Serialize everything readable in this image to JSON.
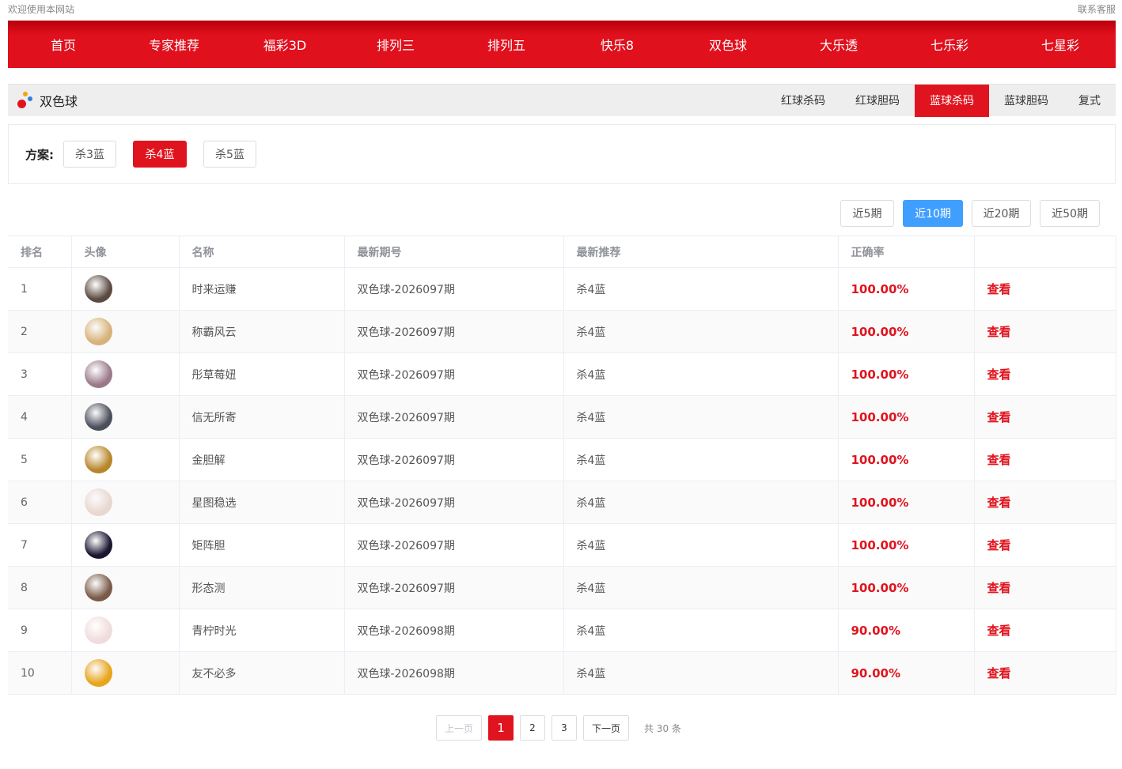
{
  "topbar": {
    "welcome": "欢迎使用本网站",
    "contact": "联系客服"
  },
  "nav": [
    "首页",
    "专家推荐",
    "福彩3D",
    "排列三",
    "排列五",
    "快乐8",
    "双色球",
    "大乐透",
    "七乐彩",
    "七星彩"
  ],
  "section": {
    "title": "双色球",
    "tabs": [
      "红球杀码",
      "红球胆码",
      "蓝球杀码",
      "蓝球胆码",
      "复式"
    ],
    "active_tab": "蓝球杀码"
  },
  "plan": {
    "label": "方案:",
    "options": [
      "杀3蓝",
      "杀4蓝",
      "杀5蓝"
    ],
    "active": "杀4蓝"
  },
  "periods": {
    "options": [
      "近5期",
      "近10期",
      "近20期",
      "近50期"
    ],
    "active": "近10期"
  },
  "table": {
    "headers": [
      "排名",
      "头像",
      "名称",
      "最新期号",
      "最新推荐",
      "正确率",
      ""
    ],
    "rows": [
      {
        "rank": "1",
        "avatar_color": "#5a4a40",
        "name": "时来运赚",
        "issue": "双色球-2026097期",
        "rec": "杀4蓝",
        "rate": "100.00%",
        "action": "查看"
      },
      {
        "rank": "2",
        "avatar_color": "#d8b27a",
        "name": "称霸风云",
        "issue": "双色球-2026097期",
        "rec": "杀4蓝",
        "rate": "100.00%",
        "action": "查看"
      },
      {
        "rank": "3",
        "avatar_color": "#9a7a8a",
        "name": "彤草莓妞",
        "issue": "双色球-2026097期",
        "rec": "杀4蓝",
        "rate": "100.00%",
        "action": "查看"
      },
      {
        "rank": "4",
        "avatar_color": "#4a4f5a",
        "name": "信无所寄",
        "issue": "双色球-2026097期",
        "rec": "杀4蓝",
        "rate": "100.00%",
        "action": "查看"
      },
      {
        "rank": "5",
        "avatar_color": "#b8862a",
        "name": "金胆解",
        "issue": "双色球-2026097期",
        "rec": "杀4蓝",
        "rate": "100.00%",
        "action": "查看"
      },
      {
        "rank": "6",
        "avatar_color": "#e8d8d0",
        "name": "星图稳选",
        "issue": "双色球-2026097期",
        "rec": "杀4蓝",
        "rate": "100.00%",
        "action": "查看"
      },
      {
        "rank": "7",
        "avatar_color": "#1a1530",
        "name": "矩阵胆",
        "issue": "双色球-2026097期",
        "rec": "杀4蓝",
        "rate": "100.00%",
        "action": "查看"
      },
      {
        "rank": "8",
        "avatar_color": "#7a5a48",
        "name": "形态测",
        "issue": "双色球-2026097期",
        "rec": "杀4蓝",
        "rate": "100.00%",
        "action": "查看"
      },
      {
        "rank": "9",
        "avatar_color": "#f0dcdc",
        "name": "青柠时光",
        "issue": "双色球-2026098期",
        "rec": "杀4蓝",
        "rate": "90.00%",
        "action": "查看"
      },
      {
        "rank": "10",
        "avatar_color": "#e8a41a",
        "name": "友不必多",
        "issue": "双色球-2026098期",
        "rec": "杀4蓝",
        "rate": "90.00%",
        "action": "查看"
      }
    ]
  },
  "pagination": {
    "prev": "上一页",
    "pages": [
      "1",
      "2",
      "3"
    ],
    "current": "1",
    "next": "下一页",
    "total": "共 30 条"
  }
}
